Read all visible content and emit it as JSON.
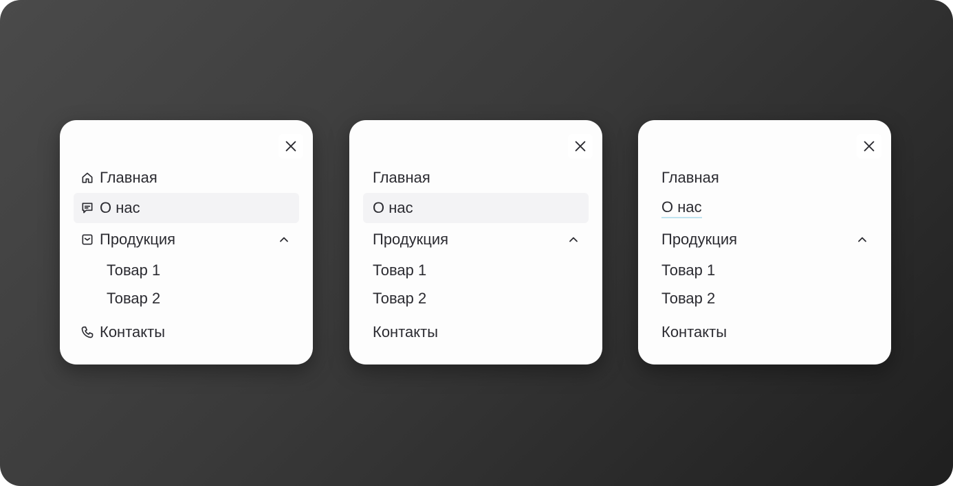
{
  "cards": [
    {
      "variant": "with-icons",
      "close_icon": "close-icon",
      "items": [
        {
          "label": "Главная",
          "icon": "home-icon"
        },
        {
          "label": "О нас",
          "icon": "message-icon",
          "state": "active"
        },
        {
          "label": "Продукция",
          "icon": "inbox-icon",
          "expanded": true,
          "chevron": "chevron-up-icon"
        },
        {
          "label": "Товар 1",
          "sub": true
        },
        {
          "label": "Товар 2",
          "sub": true
        },
        {
          "label": "Контакты",
          "icon": "phone-icon"
        }
      ]
    },
    {
      "variant": "no-icons",
      "close_icon": "close-icon",
      "items": [
        {
          "label": "Главная"
        },
        {
          "label": "О нас",
          "state": "active"
        },
        {
          "label": "Продукция",
          "expanded": true,
          "chevron": "chevron-up-icon"
        },
        {
          "label": "Товар 1",
          "sub": true
        },
        {
          "label": "Товар 2",
          "sub": true
        },
        {
          "label": "Контакты"
        }
      ]
    },
    {
      "variant": "no-icons-underline",
      "close_icon": "close-icon",
      "items": [
        {
          "label": "Главная"
        },
        {
          "label": "О нас",
          "state": "underlined"
        },
        {
          "label": "Продукция",
          "expanded": true,
          "chevron": "chevron-up-icon"
        },
        {
          "label": "Товар 1",
          "sub": true
        },
        {
          "label": "Товар 2",
          "sub": true
        },
        {
          "label": "Контакты"
        }
      ]
    }
  ],
  "colors": {
    "background_light": "#4a4a4a",
    "background_dark": "#1f1f1f",
    "card": "#fdfdfd",
    "active_item": "#f3f3f5",
    "text": "#2b2b31",
    "underline_accent": "#bfe3f0"
  }
}
